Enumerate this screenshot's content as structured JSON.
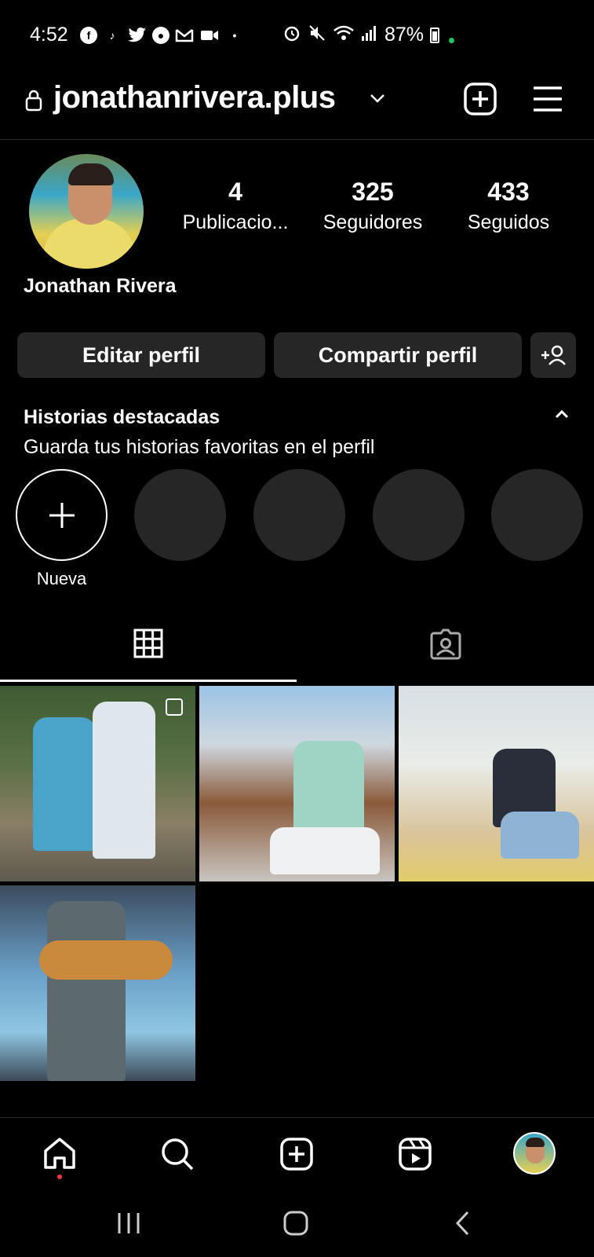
{
  "status": {
    "time": "4:52",
    "battery": "87%"
  },
  "header": {
    "username": "jonathanrivera.plus"
  },
  "profile": {
    "name": "Jonathan Rivera",
    "stats": [
      {
        "value": "4",
        "label": "Publicacio..."
      },
      {
        "value": "325",
        "label": "Seguidores"
      },
      {
        "value": "433",
        "label": "Seguidos"
      }
    ],
    "buttons": {
      "edit": "Editar perfil",
      "share": "Compartir perfil"
    }
  },
  "highlights": {
    "title": "Historias destacadas",
    "subtitle": "Guarda tus historias favoritas en el perfil",
    "new_label": "Nueva"
  },
  "icons": {
    "lock": "lock-icon",
    "add": "plus-square-icon",
    "menu": "hamburger-icon",
    "grid": "grid-icon",
    "tagged": "tagged-icon",
    "home": "home-icon",
    "search": "search-icon",
    "reels": "reels-icon"
  },
  "colors": {
    "background": "#000000",
    "button": "#262626",
    "notification": "#ff3040"
  }
}
